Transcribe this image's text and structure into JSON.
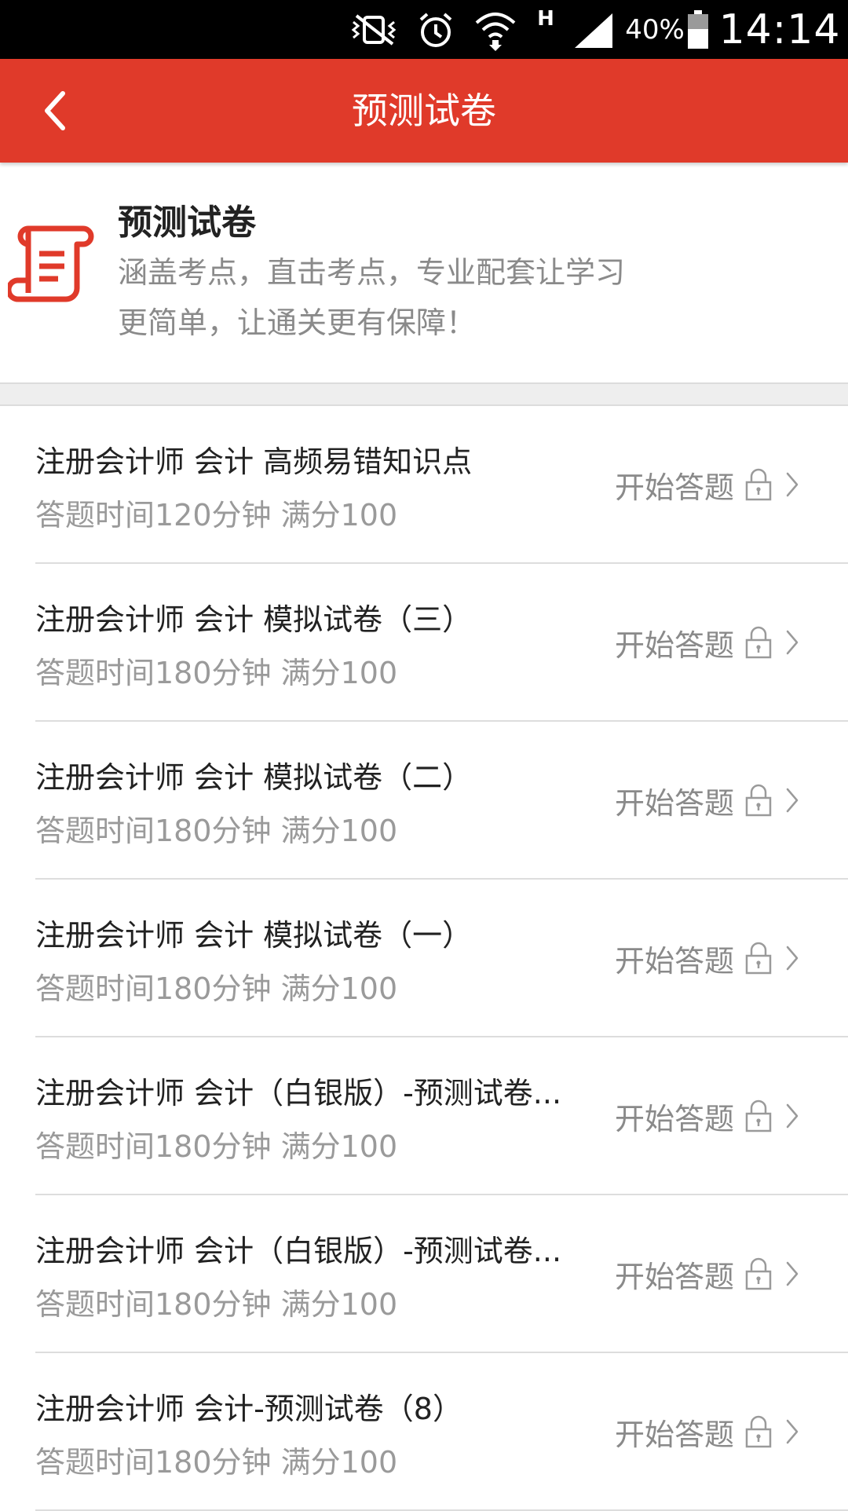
{
  "status_bar": {
    "battery_percent": "40%",
    "time": "14:14",
    "network_type": "H",
    "icons": [
      "vibrate-mute-icon",
      "alarm-icon",
      "wifi-icon",
      "signal-icon",
      "battery-icon"
    ]
  },
  "title_bar": {
    "title": "预测试卷"
  },
  "intro": {
    "title": "预测试卷",
    "description": "涵盖考点，直击考点，专业配套让学习更简单，让通关更有保障！",
    "icon": "scroll-document-icon"
  },
  "colors": {
    "accent": "#e03a2a",
    "text_primary": "#222222",
    "text_secondary": "#9a9a9a"
  },
  "exams": [
    {
      "title": "注册会计师 会计 高频易错知识点",
      "meta": "答题时间120分钟 满分100",
      "action": "开始答题"
    },
    {
      "title": "注册会计师 会计 模拟试卷（三）",
      "meta": "答题时间180分钟 满分100",
      "action": "开始答题"
    },
    {
      "title": "注册会计师 会计 模拟试卷（二）",
      "meta": "答题时间180分钟 满分100",
      "action": "开始答题"
    },
    {
      "title": "注册会计师 会计 模拟试卷（一）",
      "meta": "答题时间180分钟 满分100",
      "action": "开始答题"
    },
    {
      "title": "注册会计师 会计（白银版）-预测试卷...",
      "meta": "答题时间180分钟 满分100",
      "action": "开始答题"
    },
    {
      "title": "注册会计师 会计（白银版）-预测试卷...",
      "meta": "答题时间180分钟 满分100",
      "action": "开始答题"
    },
    {
      "title": "注册会计师 会计-预测试卷（8）",
      "meta": "答题时间180分钟 满分100",
      "action": "开始答题"
    }
  ]
}
